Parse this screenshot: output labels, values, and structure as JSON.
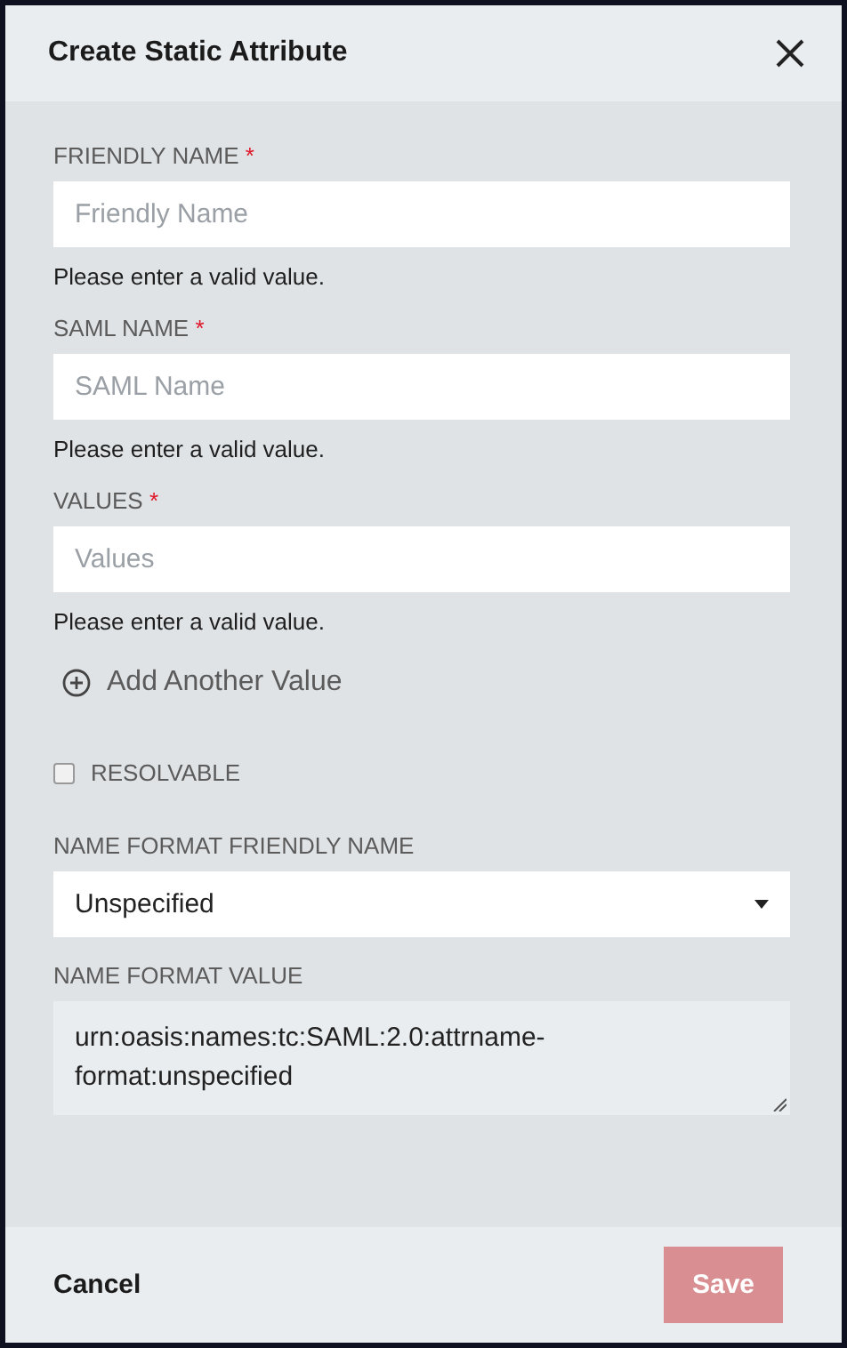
{
  "dialog": {
    "title": "Create Static Attribute"
  },
  "fields": [
    {
      "kind": "text",
      "label": "FRIENDLY NAME",
      "required_mark": "*",
      "placeholder": "Friendly Name",
      "error": "Please enter a valid value."
    },
    {
      "kind": "text",
      "label": "SAML NAME",
      "required_mark": "*",
      "placeholder": "SAML Name",
      "error": "Please enter a valid value."
    },
    {
      "kind": "text",
      "label": "VALUES",
      "required_mark": "*",
      "placeholder": "Values",
      "error": "Please enter a valid value."
    },
    {
      "kind": "link",
      "label": "Add Another Value"
    },
    {
      "kind": "checkbox",
      "label": "RESOLVABLE",
      "checked": false
    },
    {
      "kind": "select",
      "label": "NAME FORMAT FRIENDLY NAME",
      "value": "Unspecified"
    },
    {
      "kind": "textarea",
      "label": "NAME FORMAT VALUE",
      "value": "urn:oasis:names:tc:SAML:2.0:attrname-format:unspecified"
    }
  ],
  "footer": {
    "cancel": {
      "label": "Cancel",
      "disabled": false
    },
    "save": {
      "label": "Save",
      "disabled": true
    }
  }
}
